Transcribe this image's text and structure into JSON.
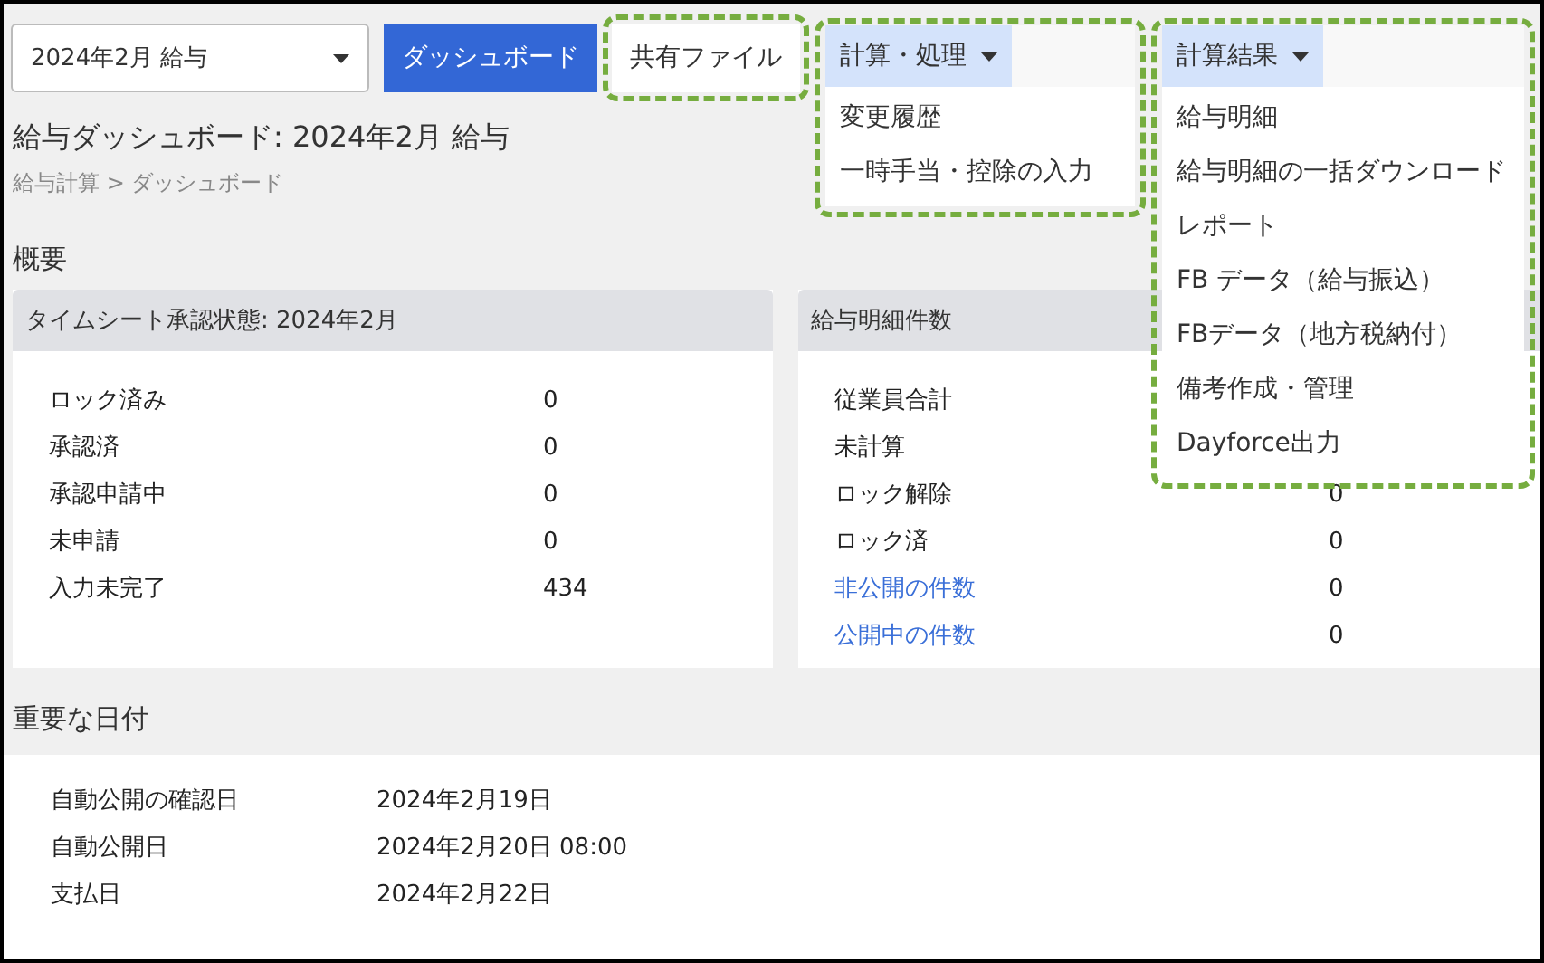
{
  "period_select": {
    "value": "2024年2月 給与"
  },
  "nav": [
    {
      "label": "ダッシュボード",
      "selected": true,
      "highlighted": false
    },
    {
      "label": "共有ファイル",
      "selected": false,
      "highlighted": true
    }
  ],
  "menus": [
    {
      "label": "計算・処理",
      "expanded": true,
      "highlighted": true,
      "items": [
        "変更履歴",
        "一時手当・控除の入力"
      ]
    },
    {
      "label": "計算結果",
      "expanded": true,
      "highlighted": true,
      "items": [
        "給与明細",
        "給与明細の一括ダウンロード",
        "レポート",
        "FB データ（給与振込）",
        "FBデータ（地方税納付）",
        "備考作成・管理",
        "Dayforce出力"
      ]
    }
  ],
  "page": {
    "title": "給与ダッシュボード: 2024年2月 給与",
    "breadcrumb": "給与計算 > ダッシュボード"
  },
  "overview": {
    "heading": "概要",
    "cards": [
      {
        "title": "タイムシート承認状態: 2024年2月",
        "rows": [
          {
            "label": "ロック済み",
            "value": "0",
            "link": false
          },
          {
            "label": "承認済",
            "value": "0",
            "link": false
          },
          {
            "label": "承認申請中",
            "value": "0",
            "link": false
          },
          {
            "label": "未申請",
            "value": "0",
            "link": false
          },
          {
            "label": "入力未完了",
            "value": "434",
            "link": false
          }
        ]
      },
      {
        "title": "給与明細件数",
        "rows": [
          {
            "label": "従業員合計",
            "link": false
          },
          {
            "label": "未計算",
            "link": false
          },
          {
            "label": "ロック解除",
            "value": "0",
            "link": false
          },
          {
            "label": "ロック済",
            "value": "0",
            "link": false
          },
          {
            "label": "非公開の件数",
            "value": "0",
            "link": true
          },
          {
            "label": "公開中の件数",
            "value": "0",
            "link": true
          }
        ]
      }
    ]
  },
  "key_dates": {
    "heading": "重要な日付",
    "rows": [
      {
        "label": "自動公開の確認日",
        "value": "2024年2月19日"
      },
      {
        "label": "自動公開日",
        "value": "2024年2月20日 08:00"
      },
      {
        "label": "支払日",
        "value": "2024年2月22日"
      }
    ]
  }
}
